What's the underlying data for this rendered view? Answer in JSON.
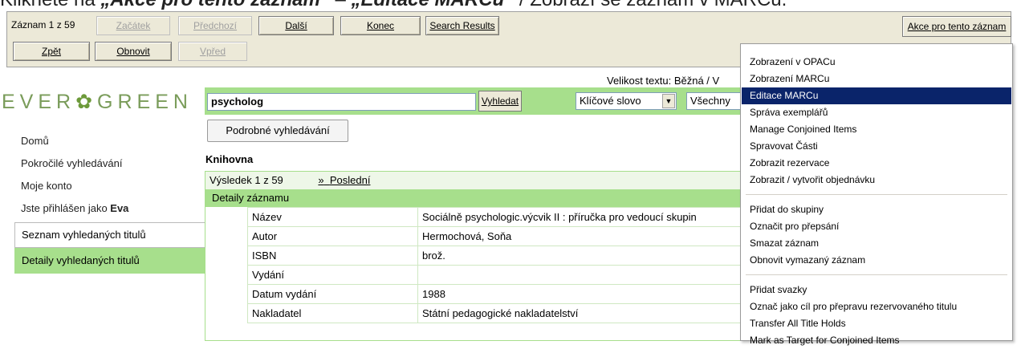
{
  "caption": {
    "pre": "Klikněte na ",
    "bold1": "„Akce pro tento záznam“",
    "mid": " – ",
    "bold2": "„Editace MARCu“",
    "post": " / Zobrazí se záznam v MARCu."
  },
  "toolbar": {
    "record_counter": "Záznam 1 z 59",
    "start": "Začátek",
    "previous": "Předchozí",
    "next": "Další",
    "end": "Konec",
    "search_results": "Search Results",
    "back": "Zpět",
    "refresh": "Obnovit",
    "forward": "Vpřed",
    "actions": "Akce pro tento záznam"
  },
  "logo": {
    "left": "EVER",
    "right": "GREEN"
  },
  "text_size": "Velikost textu: Běžná / V",
  "search": {
    "query": "psycholog",
    "button": "Vyhledat",
    "type": "Klíčové slovo",
    "format": "Všechny"
  },
  "advanced_button": "Podrobné vyhledávání",
  "library_label": "Knihovna",
  "sidebar": {
    "items": [
      "Domů",
      "Pokročilé vyhledávání",
      "Moje konto",
      "Jste přihlášen jako "
    ],
    "user": "Eva",
    "boxes": [
      "Seznam vyhledaných titulů",
      "Detaily vyhledaných titulů"
    ]
  },
  "results": {
    "counter": "Výsledek 1 z 59",
    "next_sym": "»",
    "last": "Poslední",
    "detail_header": "Detaily záznamu",
    "rows": [
      {
        "key": "Název",
        "value": "Sociálně psychologic.výcvik II : příručka pro vedoucí skupin"
      },
      {
        "key": "Autor",
        "value": "Hermochová, Soňa"
      },
      {
        "key": "ISBN",
        "value": "brož."
      },
      {
        "key": "Vydání",
        "value": ""
      },
      {
        "key": "Datum vydání",
        "value": "1988"
      },
      {
        "key": "Nakladatel",
        "value": "Státní pedagogické nakladatelství"
      }
    ]
  },
  "menu": {
    "group1": [
      "Zobrazení v OPACu",
      "Zobrazení MARCu",
      "Editace MARCu",
      "Správa exemplářů",
      "Manage Conjoined Items",
      "Spravovat Části",
      "Zobrazit rezervace",
      "Zobrazit / vytvořit objednávku"
    ],
    "group2": [
      "Přidat do skupiny",
      "Označit pro přepsání",
      "Smazat záznam",
      "Obnovit vymazaný záznam"
    ],
    "group3": [
      "Přidat svazky",
      "Označ jako cíl pro přepravu rezervovaného titulu",
      "Transfer All Title Holds",
      "Mark as Target for Conjoined Items"
    ],
    "selected": "Editace MARCu"
  },
  "colors": {
    "green": "#a7df8c",
    "toolbar": "#ece9d8",
    "menu_highlight": "#0a246a"
  }
}
